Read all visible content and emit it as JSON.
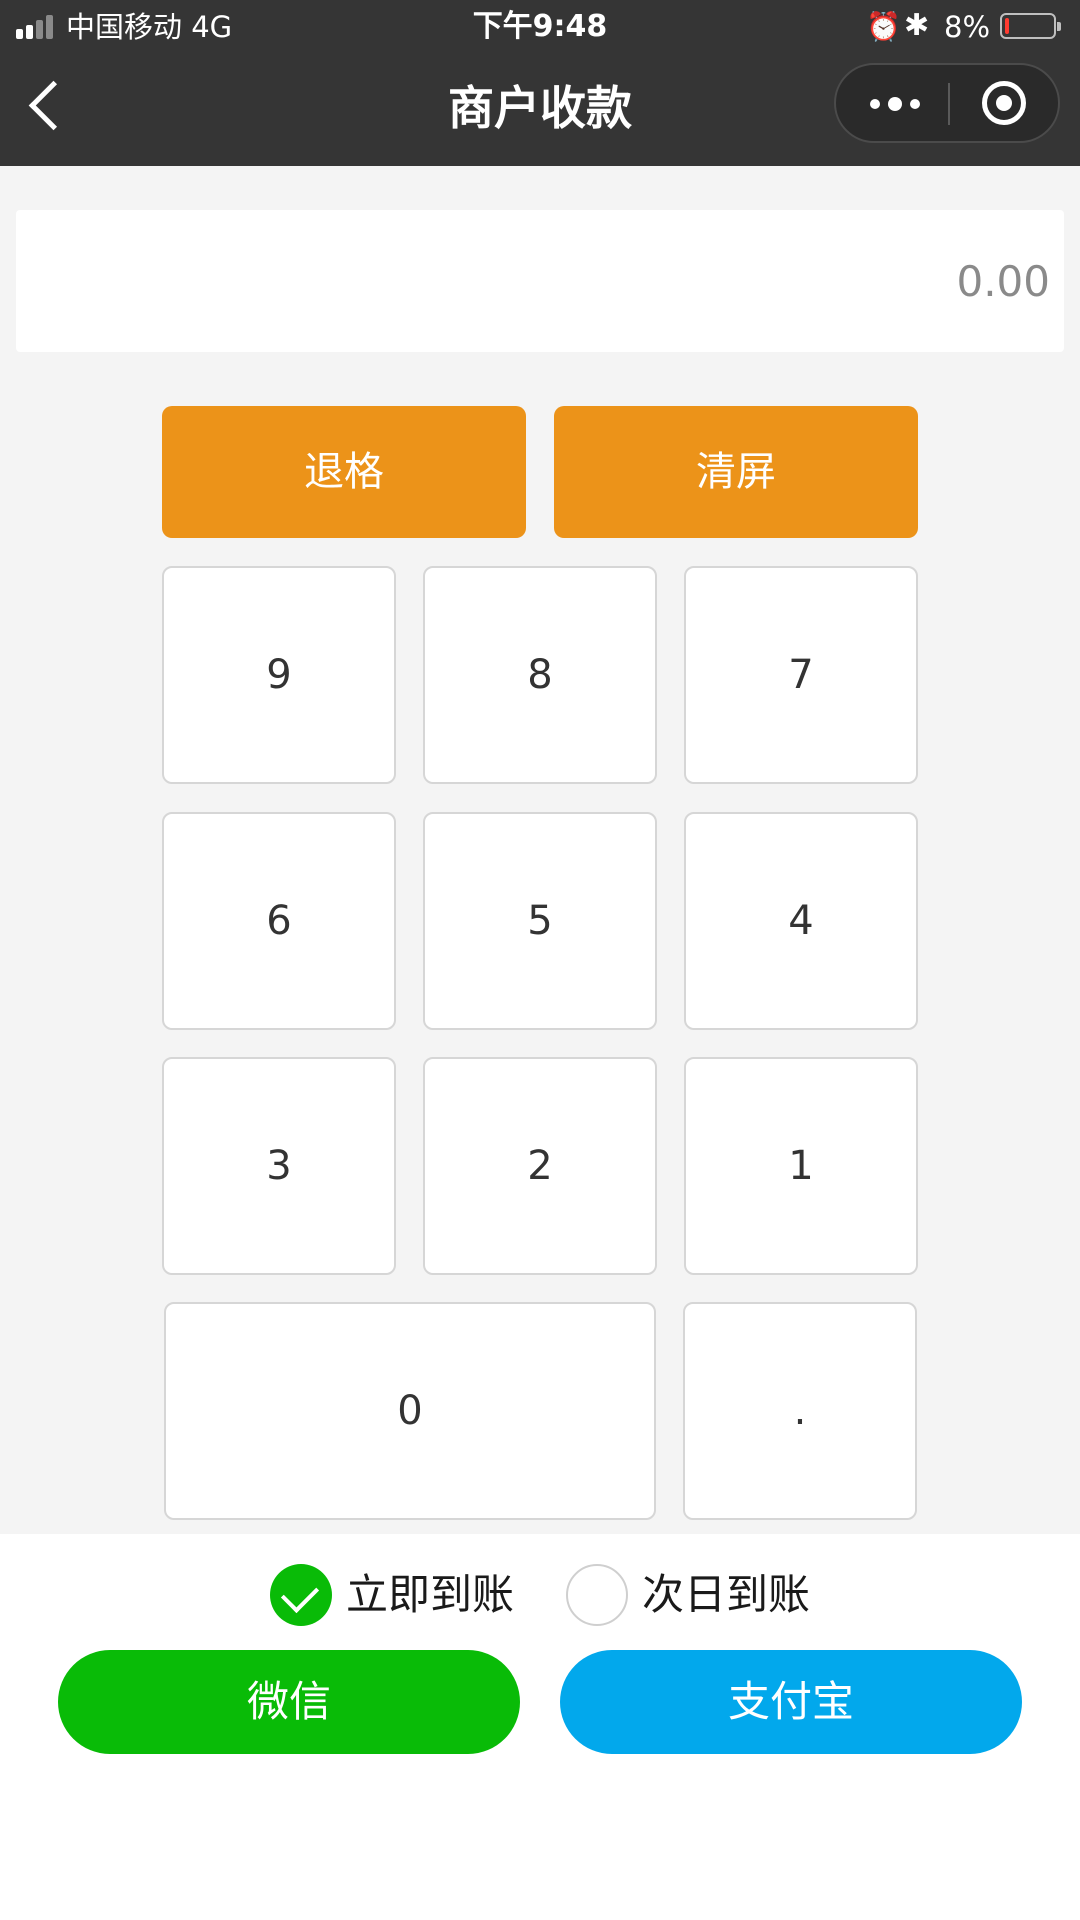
{
  "status_bar": {
    "carrier": "中国移动 4G",
    "time": "下午9:48",
    "alarm_icon": "⏰",
    "bluetooth_icon": "✱",
    "battery_percent": "8%",
    "battery_level": 0.08
  },
  "nav": {
    "title": "商户收款"
  },
  "amount": {
    "value": "0.00"
  },
  "actions": {
    "backspace": "退格",
    "clear": "清屏"
  },
  "keypad": {
    "k9": "9",
    "k8": "8",
    "k7": "7",
    "k6": "6",
    "k5": "5",
    "k4": "4",
    "k3": "3",
    "k2": "2",
    "k1": "1",
    "k0": "0",
    "dot": "."
  },
  "settlement": {
    "options": [
      {
        "label": "立即到账",
        "selected": true
      },
      {
        "label": "次日到账",
        "selected": false
      }
    ]
  },
  "payment": {
    "wechat": "微信",
    "alipay": "支付宝"
  },
  "colors": {
    "topbar": "#353535",
    "orange": "#ec9319",
    "wechat_green": "#09bb07",
    "alipay_blue": "#02a8ec",
    "battery_low": "#ff3b30"
  }
}
